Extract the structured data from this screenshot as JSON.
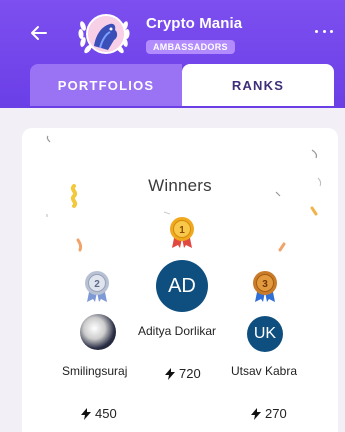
{
  "header": {
    "title": "Crypto Mania",
    "badge": "AMBASSADORS"
  },
  "tabs": [
    {
      "label": "PORTFOLIOS",
      "active": false
    },
    {
      "label": "RANKS",
      "active": true
    }
  ],
  "winners": {
    "title": "Winners",
    "first": {
      "rank": "1",
      "initials": "AD",
      "name": "Aditya Dorlikar",
      "points": "720"
    },
    "second": {
      "rank": "2",
      "name": "Smilingsuraj",
      "points": "450"
    },
    "third": {
      "rank": "3",
      "initials": "UK",
      "name": "Utsav Kabra",
      "points": "270"
    }
  },
  "colors": {
    "header_purple": "#7d4ff0",
    "tab_inactive": "#9a72f4",
    "badge": "#b28bff",
    "avatar_blue": "#0f4f7f",
    "gold": "#f0a81c",
    "silver": "#b8c1d4",
    "bronze": "#c97b2a"
  },
  "icons": [
    "back-arrow-icon",
    "more-options-icon",
    "bolt-icon",
    "medal-icon",
    "laurel-icon"
  ]
}
